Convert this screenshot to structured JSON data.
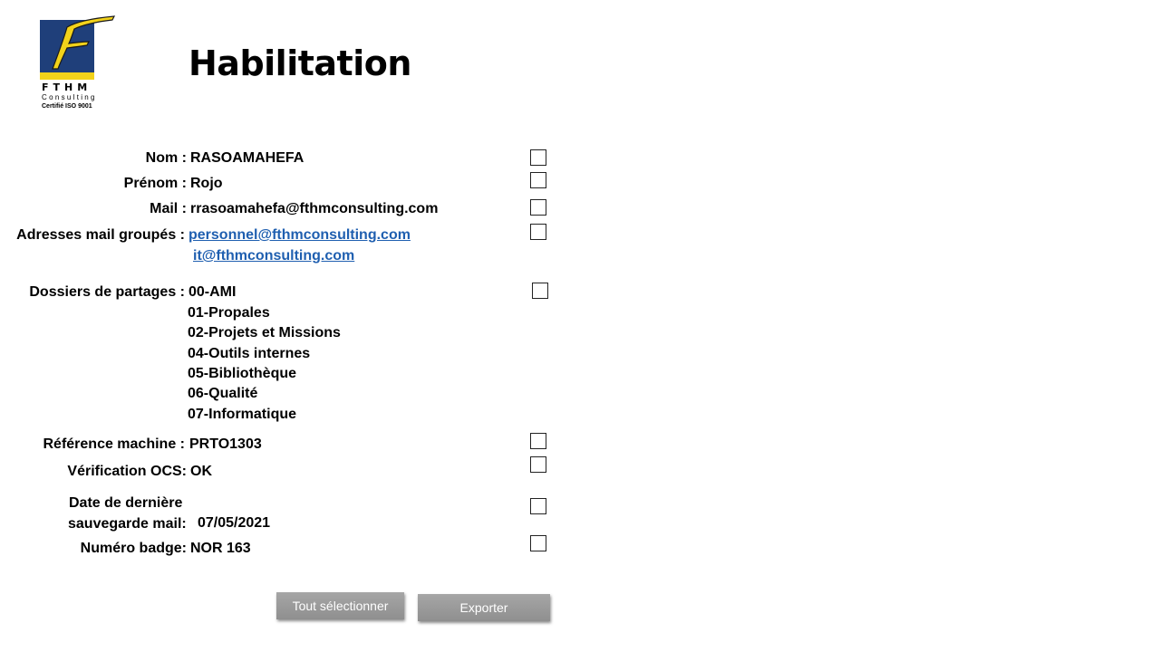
{
  "logo": {
    "name": "FTHM",
    "sub": "Consulting",
    "cert": "Certifié ISO 9001",
    "colors": {
      "square": "#1f3f7a",
      "bar": "#f2d21a",
      "letter": "#f2d21a"
    }
  },
  "title": "Habilitation",
  "fields": {
    "nom": {
      "label": "Nom :",
      "value": "RASOAMAHEFA"
    },
    "prenom": {
      "label": "Prénom :",
      "value": "Rojo"
    },
    "mail": {
      "label": "Mail :",
      "value": "rrasoamahefa@fthmconsulting.com"
    },
    "groupes": {
      "label": "Adresses mail groupés :",
      "values": [
        "personnel@fthmconsulting.com",
        "it@fthmconsulting.com"
      ]
    },
    "dossiers": {
      "label": "Dossiers de partages :",
      "values": [
        "00-AMI",
        "01-Propales",
        "02-Projets et Missions",
        "04-Outils internes",
        "05-Bibliothèque",
        "06-Qualité",
        "07-Informatique"
      ]
    },
    "machine": {
      "label": "Référence machine :",
      "value": "PRTO1303"
    },
    "ocs": {
      "label": "Vérification OCS:",
      "value": "OK"
    },
    "sauvegarde": {
      "label_line1": "Date de dernière",
      "label_line2": "sauvegarde mail:",
      "value": "07/05/2021"
    },
    "badge": {
      "label": "Numéro badge:",
      "value": "NOR 163"
    }
  },
  "buttons": {
    "select_all": "Tout sélectionner",
    "export": "Exporter"
  },
  "colors": {
    "link": "#1f5fb0",
    "button": "#9a9a9a"
  }
}
